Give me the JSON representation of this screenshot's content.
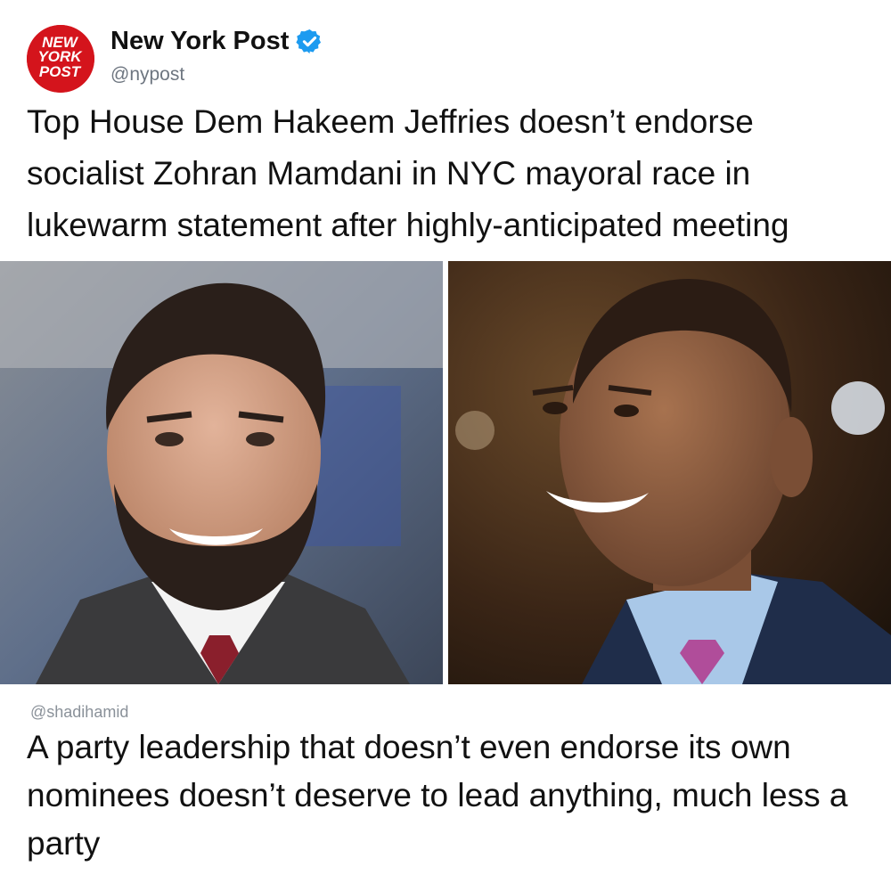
{
  "post": {
    "account_name": "New York Post",
    "handle": "@nypost",
    "avatar_logo": [
      "NEW",
      "YORK",
      "POST"
    ],
    "verified": true,
    "text": "Top House Dem Hakeem Jeffries doesn’t endorse socialist Zohran Mamdani in NYC mayoral race in lukewarm statement after highly-anticipated meeting"
  },
  "photos": [
    {
      "name": "photo-left",
      "icon": "person-photo"
    },
    {
      "name": "photo-right",
      "icon": "person-photo"
    }
  ],
  "quote": {
    "handle": "@shadihamid",
    "text": "A party leadership that doesn’t even endorse its own nominees doesn’t deserve to lead anything, much less a party"
  },
  "colors": {
    "brand_red": "#d4141c",
    "verified_blue": "#1d9bf0",
    "handle_gray": "#6e7680"
  }
}
